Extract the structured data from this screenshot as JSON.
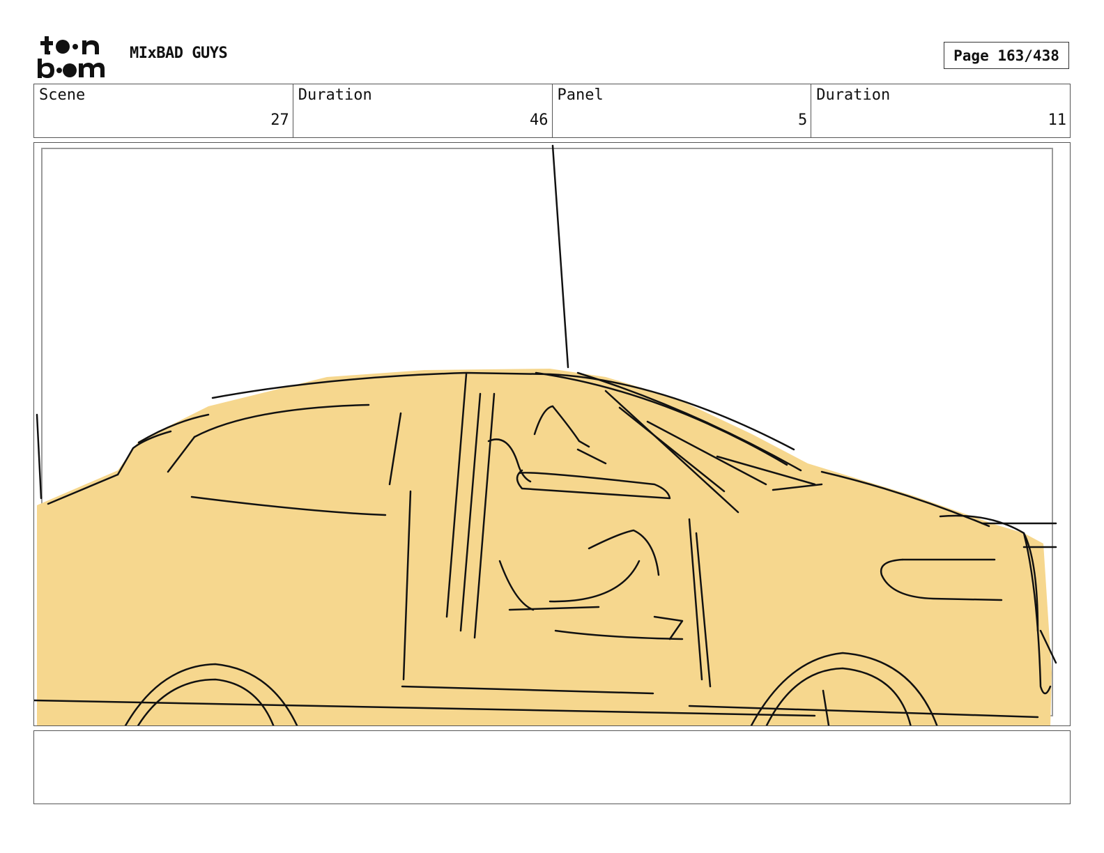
{
  "header": {
    "logo_icon": "toon-boom-logo",
    "project_title": "MIxBAD GUYS",
    "page_label": "Page 163/438"
  },
  "info": {
    "scene_label": "Scene",
    "scene_value": "27",
    "scene_duration_label": "Duration",
    "scene_duration_value": "46",
    "panel_label": "Panel",
    "panel_value": "5",
    "panel_duration_label": "Duration",
    "panel_duration_value": "11"
  },
  "panel": {
    "sketch_icon": "car-side-sketch",
    "fill_color": "#f6d78e",
    "line_color": "#111111"
  },
  "notes": {
    "text": ""
  }
}
